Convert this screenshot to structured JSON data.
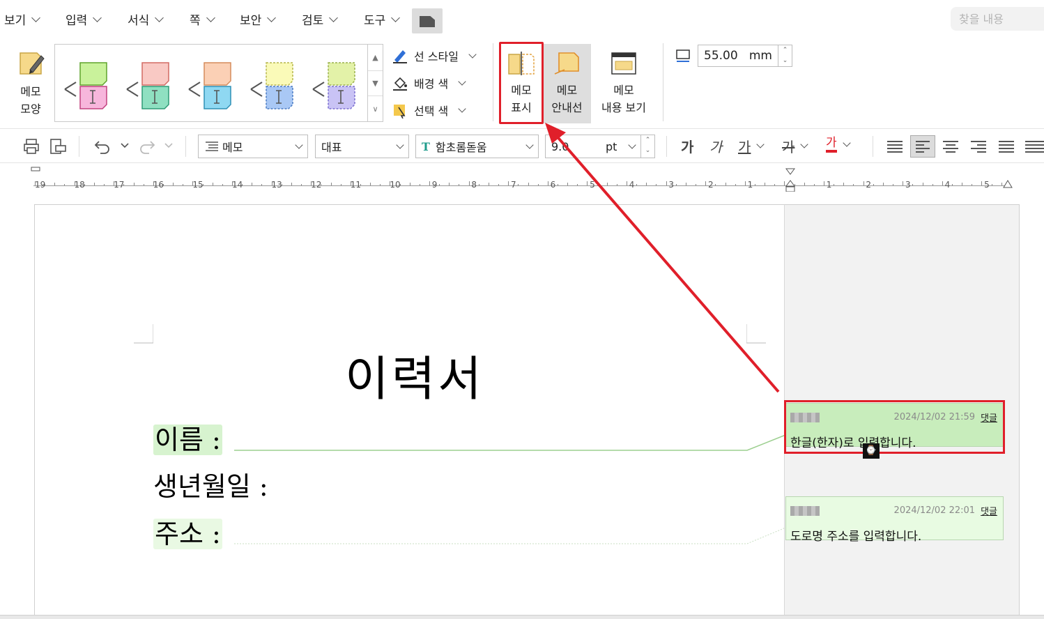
{
  "menubar": {
    "items": [
      {
        "label": "보기"
      },
      {
        "label": "입력"
      },
      {
        "label": "서식"
      },
      {
        "label": "쪽"
      },
      {
        "label": "보안"
      },
      {
        "label": "검토"
      },
      {
        "label": "도구"
      }
    ],
    "search_placeholder": "찾을 내용"
  },
  "ribbon": {
    "memo_shape": {
      "line1": "메모",
      "line2": "모양"
    },
    "line_style": "선 스타일",
    "background_color": "배경 색",
    "selection_color": "선택 색",
    "memo_show": {
      "line1": "메모",
      "line2": "표시"
    },
    "memo_guide": {
      "line1": "메모",
      "line2": "안내선"
    },
    "memo_content_view": {
      "line1": "메모",
      "line2": "내용 보기"
    },
    "memo_width": {
      "value": "55.00",
      "unit": "mm"
    }
  },
  "toolbar": {
    "style": "메모",
    "language": "대표",
    "font": "함초롬돋움",
    "font_size": {
      "value": "9.0",
      "unit": "pt"
    },
    "bold": "가",
    "italic": "가",
    "underline": "가",
    "strike": "가",
    "font_color": "가"
  },
  "ruler": {
    "left_labels": [
      "19",
      "18",
      "17",
      "16",
      "15",
      "14",
      "13",
      "12",
      "11",
      "10",
      "9",
      "8",
      "7",
      "6",
      "5",
      "4",
      "3",
      "2",
      "1"
    ],
    "right_labels": [
      "1",
      "2",
      "3",
      "4",
      "5"
    ]
  },
  "document": {
    "title": "이력서",
    "field_name": "이름  :",
    "field_birth": "생년월일  :",
    "field_address": "주소  :"
  },
  "memos": [
    {
      "date": "2024/12/02 21:59",
      "reply": "댓글",
      "text": "한글(한자)로 입력합니다."
    },
    {
      "date": "2024/12/02 22:01",
      "reply": "댓글",
      "text": "도로명 주소를 입력합니다."
    }
  ],
  "colors": {
    "highlight_red": "#e01f2a",
    "memo_green": "#c8edbc"
  }
}
